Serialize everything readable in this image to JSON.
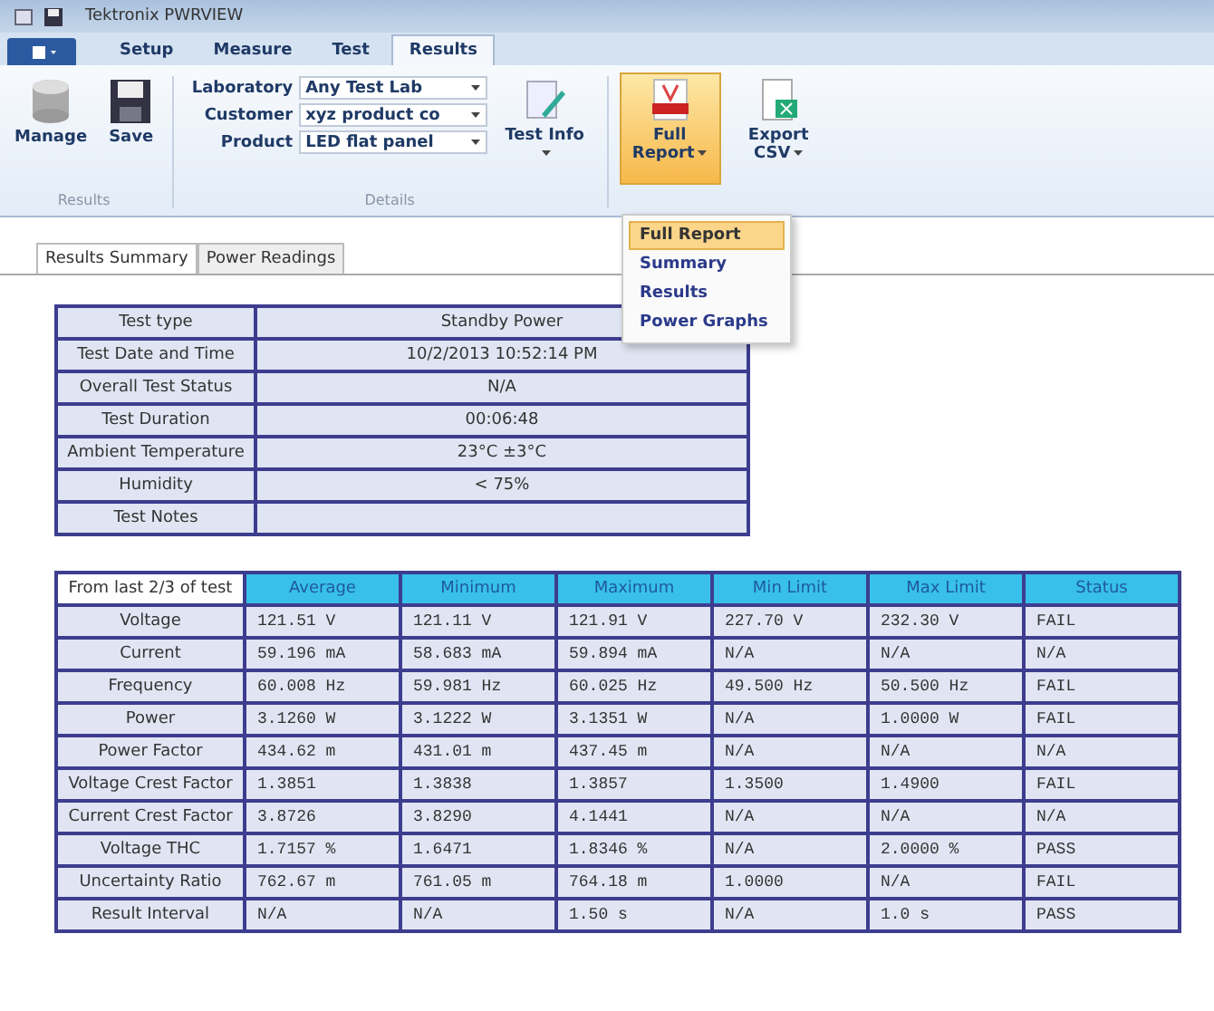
{
  "window": {
    "title": "Tektronix PWRVIEW"
  },
  "ribbon_tabs": [
    {
      "label": "Setup",
      "selected": false
    },
    {
      "label": "Measure",
      "selected": false
    },
    {
      "label": "Test",
      "selected": false
    },
    {
      "label": "Results",
      "selected": true
    }
  ],
  "results_group": {
    "label": "Results",
    "buttons": [
      {
        "label": "Manage",
        "kind": "database"
      },
      {
        "label": "Save",
        "kind": "disk"
      }
    ]
  },
  "details_group": {
    "label": "Details",
    "fields": [
      {
        "label": "Laboratory",
        "value": "Any Test Lab"
      },
      {
        "label": "Customer",
        "value": "xyz product co"
      },
      {
        "label": "Product",
        "value": "LED flat panel"
      }
    ],
    "button": {
      "label": "Test Info"
    }
  },
  "report_group": {
    "buttons": [
      {
        "label": "Full Report",
        "kind": "pdf",
        "selected": true
      },
      {
        "label": "Export CSV",
        "kind": "excel",
        "selected": false
      }
    ]
  },
  "report_menu": [
    {
      "label": "Full Report",
      "selected": true
    },
    {
      "label": "Summary",
      "selected": false
    },
    {
      "label": "Results",
      "selected": false
    },
    {
      "label": "Power Graphs",
      "selected": false
    }
  ],
  "doc_tabs": [
    {
      "label": "Results Summary",
      "selected": true
    },
    {
      "label": "Power Readings",
      "selected": false
    }
  ],
  "summary_table": [
    {
      "label": "Test type",
      "value": "Standby Power"
    },
    {
      "label": "Test Date and Time",
      "value": "10/2/2013 10:52:14 PM"
    },
    {
      "label": "Overall Test Status",
      "value": "N/A"
    },
    {
      "label": "Test Duration",
      "value": "00:06:48"
    },
    {
      "label": "Ambient Temperature",
      "value": "23°C ±3°C"
    },
    {
      "label": "Humidity",
      "value": "< 75%"
    },
    {
      "label": "Test Notes"
    }
  ],
  "measurements": {
    "corner": "From last 2/3 of test",
    "columns": [
      "Average",
      "Minimum",
      "Maximum",
      "Min Limit",
      "Max Limit",
      "Status"
    ],
    "rows": [
      {
        "label": "Voltage",
        "cells": [
          "121.51 V",
          "121.11 V",
          "121.91 V",
          "227.70 V",
          "232.30 V",
          "FAIL"
        ]
      },
      {
        "label": "Current",
        "cells": [
          "59.196 mA",
          "58.683 mA",
          "59.894 mA",
          "N/A",
          "N/A",
          "N/A"
        ]
      },
      {
        "label": "Frequency",
        "cells": [
          "60.008 Hz",
          "59.981 Hz",
          "60.025 Hz",
          "49.500 Hz",
          "50.500 Hz",
          "FAIL"
        ]
      },
      {
        "label": "Power",
        "cells": [
          "3.1260 W",
          "3.1222 W",
          "3.1351 W",
          "N/A",
          "1.0000 W",
          "FAIL"
        ]
      },
      {
        "label": "Power Factor",
        "cells": [
          "434.62 m",
          "431.01 m",
          "437.45 m",
          "N/A",
          "N/A",
          "N/A"
        ]
      },
      {
        "label": "Voltage Crest Factor",
        "cells": [
          "1.3851",
          "1.3838",
          "1.3857",
          "1.3500",
          "1.4900",
          "FAIL"
        ]
      },
      {
        "label": "Current Crest Factor",
        "cells": [
          "3.8726",
          "3.8290",
          "4.1441",
          "N/A",
          "N/A",
          "N/A"
        ]
      },
      {
        "label": "Voltage THC",
        "cells": [
          "1.7157 %",
          "1.6471",
          "1.8346 %",
          "N/A",
          "2.0000 %",
          "PASS"
        ]
      },
      {
        "label": "Uncertainty Ratio",
        "cells": [
          "762.67 m",
          "761.05 m",
          "764.18 m",
          "1.0000",
          "N/A",
          "FAIL"
        ]
      },
      {
        "label": "Result Interval",
        "cells": [
          "N/A",
          "N/A",
          "1.50 s",
          "N/A",
          "1.0 s",
          "PASS"
        ]
      }
    ]
  }
}
